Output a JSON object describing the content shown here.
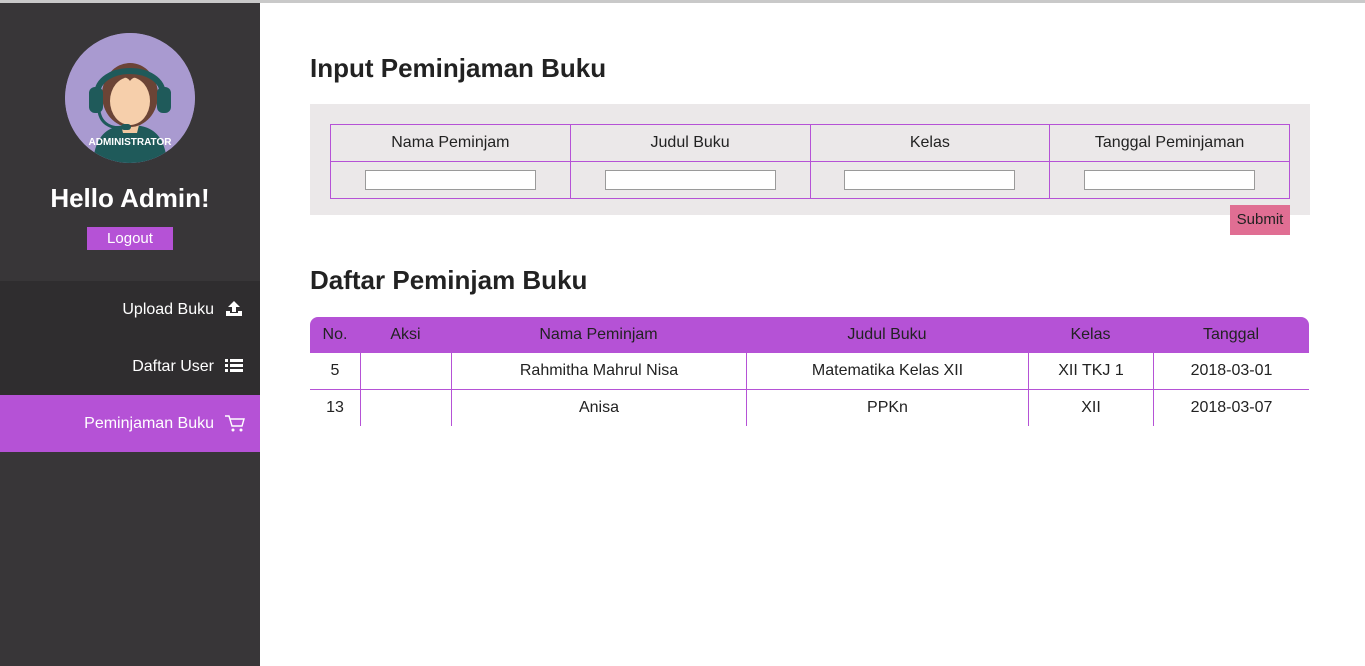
{
  "sidebar": {
    "avatar_text": "ADMINISTRATOR",
    "greeting": "Hello Admin!",
    "logout_label": "Logout",
    "nav": [
      {
        "label": "Upload Buku",
        "icon": "upload-icon"
      },
      {
        "label": "Daftar User",
        "icon": "list-icon"
      },
      {
        "label": "Peminjaman Buku",
        "icon": "cart-icon",
        "active": true
      }
    ]
  },
  "form": {
    "title": "Input Peminjaman Buku",
    "columns": [
      "Nama Peminjam",
      "Judul Buku",
      "Kelas",
      "Tanggal Peminjaman"
    ],
    "values": [
      "",
      "",
      "",
      ""
    ],
    "submit_label": "Submit"
  },
  "list": {
    "title": "Daftar Peminjam Buku",
    "headers": [
      "No.",
      "Aksi",
      "Nama Peminjam",
      "Judul Buku",
      "Kelas",
      "Tanggal"
    ],
    "rows": [
      {
        "no": "5",
        "aksi": "",
        "nama": "Rahmitha Mahrul Nisa",
        "judul": "Matematika Kelas XII",
        "kelas": "XII TKJ 1",
        "tanggal": "2018-03-01"
      },
      {
        "no": "13",
        "aksi": "",
        "nama": "Anisa",
        "judul": "PPKn",
        "kelas": "XII",
        "tanggal": "2018-03-07"
      }
    ]
  },
  "colors": {
    "accent": "#b552d6",
    "sidebar_bg": "#383638",
    "submit_bg": "#e06e93",
    "form_bg": "#ebe8e9"
  }
}
